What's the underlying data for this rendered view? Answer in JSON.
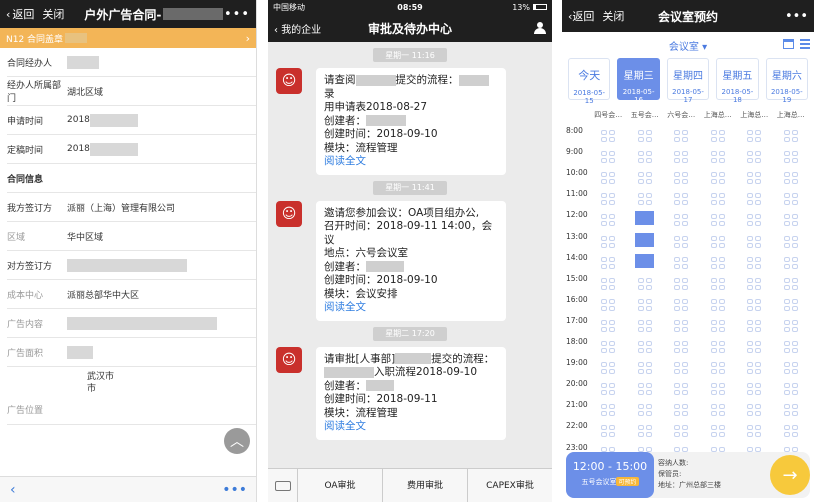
{
  "panel1": {
    "nav": {
      "back_label": "返回",
      "close_label": "关闭",
      "title": "户外广告合同-",
      "more_label": "•••"
    },
    "banner": {
      "text": "N12 合同盖章"
    },
    "rows": [
      {
        "label": "合同经办人",
        "value": "",
        "style": "normal"
      },
      {
        "label": "经办人所属部门",
        "value": "湖北区域",
        "style": "normal"
      },
      {
        "label": "申请时间",
        "value": "2018",
        "style": "normal"
      },
      {
        "label": "定稿时间",
        "value": "2018",
        "style": "normal"
      },
      {
        "label": "合同信息",
        "value": "",
        "style": "section"
      },
      {
        "label": "我方签订方",
        "value": "派丽（上海）管理有限公司",
        "style": "normal"
      },
      {
        "label": "区域",
        "value": "华中区域",
        "style": "grey"
      },
      {
        "label": "对方签订方",
        "value": "",
        "style": "normal"
      },
      {
        "label": "成本中心",
        "value": "派丽总部华中大区",
        "style": "grey"
      },
      {
        "label": "广告内容",
        "value": "",
        "style": "grey"
      },
      {
        "label": "广告面积",
        "value": "",
        "style": "grey"
      }
    ],
    "location": {
      "label": "广告位置",
      "city1": "武汉市",
      "city2": "市"
    },
    "scroll_top_icon": "chevron-up-icon",
    "bottom": {
      "back_icon": "chevron-left-icon",
      "more_label": "•••"
    }
  },
  "panel2": {
    "status": {
      "carrier": "中国移动",
      "time": "08:59",
      "battery": "13%"
    },
    "nav": {
      "back_label": "我的企业",
      "title": "审批及待办中心"
    },
    "messages": [
      {
        "time": "星期一 11:16",
        "lines": [
          "请查阅",
          "提交的流程：",
          "录",
          "用申请表2018-08-27",
          "创建者：",
          "创建时间：2018-09-10",
          "模块：流程管理"
        ],
        "link": "阅读全文"
      },
      {
        "time": "星期一 11:41",
        "lines": [
          "邀请您参加会议：OA项目组办公,",
          "召开时间：2018-09-11 14:00，会议",
          "地点：六号会议室",
          "创建者：",
          "创建时间：2018-09-10",
          "模块：会议安排"
        ],
        "link": "阅读全文"
      },
      {
        "time": "星期二 17:20",
        "lines": [
          "请审批[人事部]",
          "提交的流程：",
          "入职流程2018-09-10",
          "创建者：",
          "创建时间：2018-09-11",
          "模块：流程管理"
        ],
        "link": "阅读全文"
      }
    ],
    "bottom_tabs": [
      "OA审批",
      "费用审批",
      "CAPEX审批"
    ]
  },
  "panel3": {
    "nav": {
      "back_label": "返回",
      "close_label": "关闭",
      "title": "会议室预约",
      "more_label": "•••"
    },
    "room_selector": "会议室 ▾",
    "days": [
      {
        "name": "今天",
        "date": "2018-05-15"
      },
      {
        "name": "星期三",
        "date": "2018-05-16",
        "selected": true
      },
      {
        "name": "星期四",
        "date": "2018-05-17"
      },
      {
        "name": "星期五",
        "date": "2018-05-18"
      },
      {
        "name": "星期六",
        "date": "2018-05-19"
      }
    ],
    "rooms": [
      "四号会…",
      "五号会…",
      "六号会…",
      "上海总…",
      "上海总…",
      "上海总…"
    ],
    "hours": [
      "8:00",
      "9:00",
      "10:00",
      "11:00",
      "12:00",
      "13:00",
      "14:00",
      "15:00",
      "16:00",
      "17:00",
      "18:00",
      "19:00",
      "20:00",
      "21:00",
      "22:00",
      "23:00"
    ],
    "booked": [
      {
        "room": 1,
        "hour": 4
      },
      {
        "room": 1,
        "hour": 5
      },
      {
        "room": 1,
        "hour": 6
      }
    ],
    "booking": {
      "time_range": "12:00 - 15:00",
      "room_name": "五号会议室",
      "tag": "可预约",
      "attendees_label": "容纳人数:",
      "keeper_label": "保管员:",
      "address_label": "地址：广州总部三楼"
    },
    "colors": {
      "accent": "#6c8fe8",
      "go_button": "#f7c93c"
    }
  }
}
